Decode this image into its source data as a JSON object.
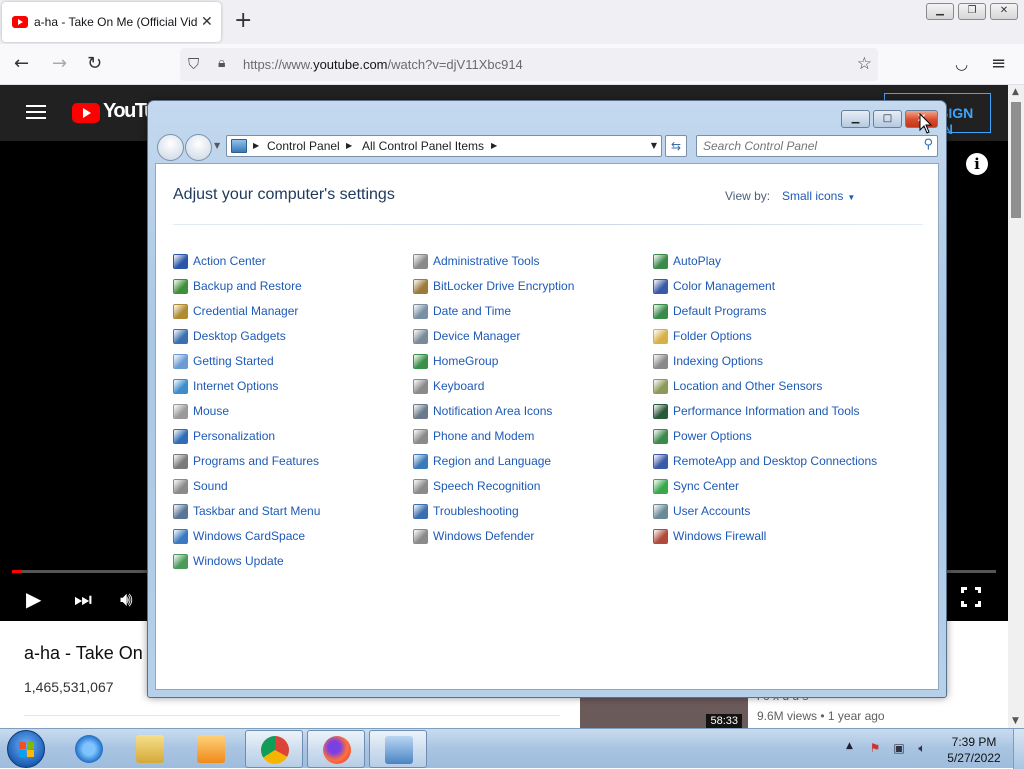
{
  "browser": {
    "tab_title": "a-ha - Take On Me (Official Video)",
    "tab_close": "✕",
    "new_tab": "+",
    "url_prefix": "https://www.",
    "url_domain": "youtube.com",
    "url_path": "/watch?v=djV11Xbc914",
    "back": "←",
    "forward": "→",
    "reload": "↻",
    "menu": "≡"
  },
  "youtube": {
    "logo_text": "YouTube",
    "sign_in": "SIGN IN",
    "video_title": "a-ha - Take On Me (Official Video)",
    "views": "1,465,531,067",
    "rec_duration": "58:33",
    "rec_meta": "9.6M views • 1 year ago",
    "rec_title_fragment": "l o x d u s",
    "progress_fraction": 0.01
  },
  "control_panel": {
    "breadcrumb": [
      "Control Panel",
      "All Control Panel Items"
    ],
    "search_placeholder": "Search Control Panel",
    "heading": "Adjust your computer's settings",
    "view_by_label": "View by:",
    "view_by_value": "Small icons",
    "columns": [
      [
        {
          "label": "Action Center",
          "icon": "flag-icon",
          "color": "#2a55a8"
        },
        {
          "label": "Backup and Restore",
          "icon": "backup-icon",
          "color": "#3f8f3a"
        },
        {
          "label": "Credential Manager",
          "icon": "vault-icon",
          "color": "#b08a2e"
        },
        {
          "label": "Desktop Gadgets",
          "icon": "gadgets-icon",
          "color": "#3a6fb0"
        },
        {
          "label": "Getting Started",
          "icon": "getting-started-icon",
          "color": "#6a9bd4"
        },
        {
          "label": "Internet Options",
          "icon": "internet-options-icon",
          "color": "#3d8ccc"
        },
        {
          "label": "Mouse",
          "icon": "mouse-icon",
          "color": "#9a9a9a"
        },
        {
          "label": "Personalization",
          "icon": "personalization-icon",
          "color": "#2f6db8"
        },
        {
          "label": "Programs and Features",
          "icon": "programs-icon",
          "color": "#7a7a7a"
        },
        {
          "label": "Sound",
          "icon": "speaker-icon",
          "color": "#8a8a8a"
        },
        {
          "label": "Taskbar and Start Menu",
          "icon": "taskbar-icon",
          "color": "#5a7696"
        },
        {
          "label": "Windows CardSpace",
          "icon": "cardspace-icon",
          "color": "#3a79c2"
        },
        {
          "label": "Windows Update",
          "icon": "windows-update-icon",
          "color": "#4a9a5a"
        }
      ],
      [
        {
          "label": "Administrative Tools",
          "icon": "admin-tools-icon",
          "color": "#8a8a8a"
        },
        {
          "label": "BitLocker Drive Encryption",
          "icon": "bitlocker-icon",
          "color": "#9c7a3a"
        },
        {
          "label": "Date and Time",
          "icon": "clock-icon",
          "color": "#7a8ea4"
        },
        {
          "label": "Device Manager",
          "icon": "device-manager-icon",
          "color": "#7a8a9a"
        },
        {
          "label": "HomeGroup",
          "icon": "homegroup-icon",
          "color": "#3a8f4a"
        },
        {
          "label": "Keyboard",
          "icon": "keyboard-icon",
          "color": "#8a8a8a"
        },
        {
          "label": "Notification Area Icons",
          "icon": "notification-icon",
          "color": "#6a7a8a"
        },
        {
          "label": "Phone and Modem",
          "icon": "phone-modem-icon",
          "color": "#8a8a8a"
        },
        {
          "label": "Region and Language",
          "icon": "globe-icon",
          "color": "#3a7ab8"
        },
        {
          "label": "Speech Recognition",
          "icon": "microphone-icon",
          "color": "#8a8a8a"
        },
        {
          "label": "Troubleshooting",
          "icon": "troubleshooting-icon",
          "color": "#3a6fb0"
        },
        {
          "label": "Windows Defender",
          "icon": "defender-icon",
          "color": "#8a8a8a"
        }
      ],
      [
        {
          "label": "AutoPlay",
          "icon": "autoplay-icon",
          "color": "#3a8a4a"
        },
        {
          "label": "Color Management",
          "icon": "color-management-icon",
          "color": "#3a5aa8"
        },
        {
          "label": "Default Programs",
          "icon": "default-programs-icon",
          "color": "#3a8a4a"
        },
        {
          "label": "Folder Options",
          "icon": "folder-icon",
          "color": "#d8b048"
        },
        {
          "label": "Indexing Options",
          "icon": "indexing-icon",
          "color": "#8a8a8a"
        },
        {
          "label": "Location and Other Sensors",
          "icon": "sensors-icon",
          "color": "#8a9a5a"
        },
        {
          "label": "Performance Information and Tools",
          "icon": "performance-icon",
          "color": "#2a5a3a"
        },
        {
          "label": "Power Options",
          "icon": "power-icon",
          "color": "#3a8a4a"
        },
        {
          "label": "RemoteApp and Desktop Connections",
          "icon": "remoteapp-icon",
          "color": "#3a5aa8"
        },
        {
          "label": "Sync Center",
          "icon": "sync-icon",
          "color": "#3aa84a"
        },
        {
          "label": "User Accounts",
          "icon": "user-accounts-icon",
          "color": "#6a8a9a"
        },
        {
          "label": "Windows Firewall",
          "icon": "firewall-icon",
          "color": "#b04a3a"
        }
      ]
    ]
  },
  "taskbar": {
    "time": "7:39 PM",
    "date": "5/27/2022",
    "apps": [
      "ie-icon",
      "explorer-icon",
      "media-player-icon",
      "chrome-icon",
      "firefox-icon",
      "control-panel-icon"
    ]
  },
  "colors": {
    "link": "#1e5ab6",
    "heading": "#1e395b",
    "youtube_red": "#ff0000"
  }
}
